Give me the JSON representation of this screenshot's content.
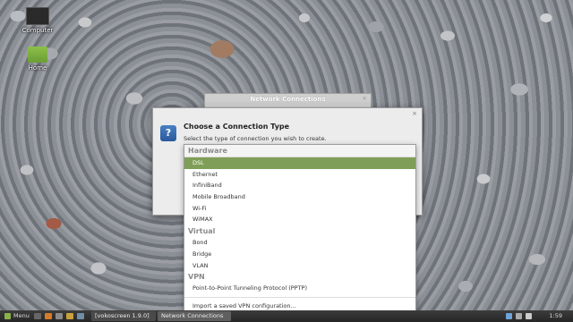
{
  "desktop": {
    "icons": [
      {
        "label": "Computer"
      },
      {
        "label": "Home"
      }
    ]
  },
  "background_window": {
    "title": "Network Connections",
    "close": "×"
  },
  "dialog": {
    "icon_glyph": "?",
    "title": "Choose a Connection Type",
    "subtitle": "Select the type of connection you wish to create.",
    "close": "×"
  },
  "dropdown": {
    "sections": [
      {
        "label": "Hardware"
      },
      {
        "label": "Virtual"
      },
      {
        "label": "VPN"
      }
    ],
    "hardware_items": [
      "DSL",
      "Ethernet",
      "InfiniBand",
      "Mobile Broadband",
      "Wi-Fi",
      "WiMAX"
    ],
    "virtual_items": [
      "Bond",
      "Bridge",
      "VLAN"
    ],
    "vpn_items": [
      "Point-to-Point Tunneling Protocol (PPTP)"
    ],
    "import_item": "Import a saved VPN configuration..."
  },
  "taskbar": {
    "menu_label": "Menu",
    "tasks": [
      "[vokoscreen 1.9.0]",
      "Network Connections"
    ],
    "clock": "1:59"
  },
  "colors": {
    "selected": "#7f9e57",
    "taskbar": "#2f2f2f",
    "accent": "#4a7fc4"
  }
}
